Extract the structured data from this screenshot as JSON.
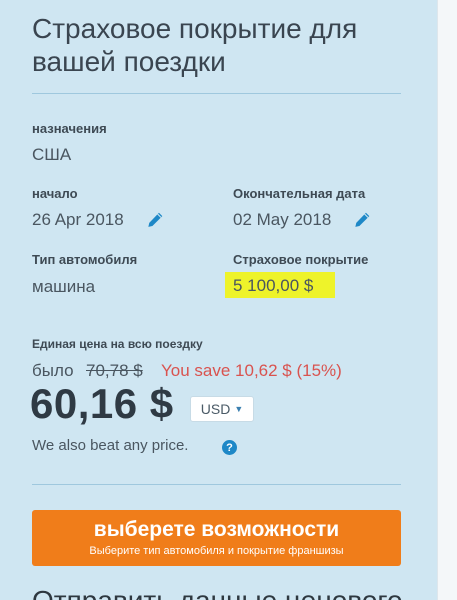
{
  "page": {
    "title": "Страховое покрытие для вашей поездки"
  },
  "trip": {
    "destination_label": "назначения",
    "destination_value": "США",
    "start_label": "начало",
    "start_value": "26 Apr 2018",
    "end_label": "Окончательная дата",
    "end_value": "02 May 2018",
    "vehicle_label": "Тип автомобиля",
    "vehicle_value": "машина",
    "coverage_label": "Страховое покрытие",
    "coverage_value": "5 100,00 $"
  },
  "pricing": {
    "label": "Единая цена на всю поездку",
    "was_prefix": "было",
    "old_price": "70,78 $",
    "save_text": "You save 10,62 $ (15%)",
    "price": "60,16 $",
    "currency": "USD",
    "beat_text": "We also beat any price.",
    "help_glyph": "?"
  },
  "cta": {
    "label": "выберете возможности",
    "sublabel": "Выберите тип автомобиля и покрытие франшизы"
  },
  "next_section": {
    "heading_partial": "Отправить данные ценового"
  },
  "colors": {
    "panel_bg": "#cfe6f2",
    "cta_bg": "#f07d1a",
    "save_text": "#d9534f",
    "highlight": "#eef32a",
    "icon_blue": "#1e88c7"
  },
  "icons": {
    "edit": "pencil-icon",
    "help": "help-icon",
    "dropdown": "caret-down-icon"
  }
}
